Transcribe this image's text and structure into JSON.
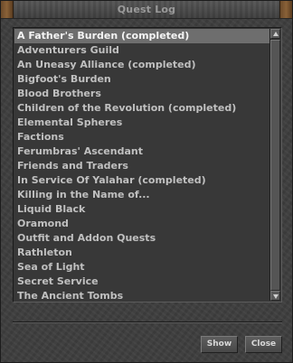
{
  "window": {
    "title": "Quest Log"
  },
  "quest_list": {
    "items": [
      {
        "label": "A Father's Burden (completed)",
        "selected": true
      },
      {
        "label": "Adventurers Guild",
        "selected": false
      },
      {
        "label": "An Uneasy Alliance (completed)",
        "selected": false
      },
      {
        "label": "Bigfoot's Burden",
        "selected": false
      },
      {
        "label": "Blood Brothers",
        "selected": false
      },
      {
        "label": "Children of the Revolution (completed)",
        "selected": false
      },
      {
        "label": "Elemental Spheres",
        "selected": false
      },
      {
        "label": "Factions",
        "selected": false
      },
      {
        "label": "Ferumbras' Ascendant",
        "selected": false
      },
      {
        "label": "Friends and Traders",
        "selected": false
      },
      {
        "label": "In Service Of Yalahar (completed)",
        "selected": false
      },
      {
        "label": "Killing in the Name of...",
        "selected": false
      },
      {
        "label": "Liquid Black",
        "selected": false
      },
      {
        "label": "Oramond",
        "selected": false
      },
      {
        "label": "Outfit and Addon Quests",
        "selected": false
      },
      {
        "label": "Rathleton",
        "selected": false
      },
      {
        "label": "Sea of Light",
        "selected": false
      },
      {
        "label": "Secret Service",
        "selected": false
      },
      {
        "label": "The Ancient Tombs",
        "selected": false
      }
    ]
  },
  "buttons": {
    "show_label": "Show",
    "close_label": "Close"
  },
  "colors": {
    "selection": "#6e6e6e",
    "text": "#c0c0c0",
    "background": "#3e3e3e"
  },
  "icons": {
    "scroll_up": "arrow-up-icon",
    "scroll_down": "arrow-down-icon"
  }
}
